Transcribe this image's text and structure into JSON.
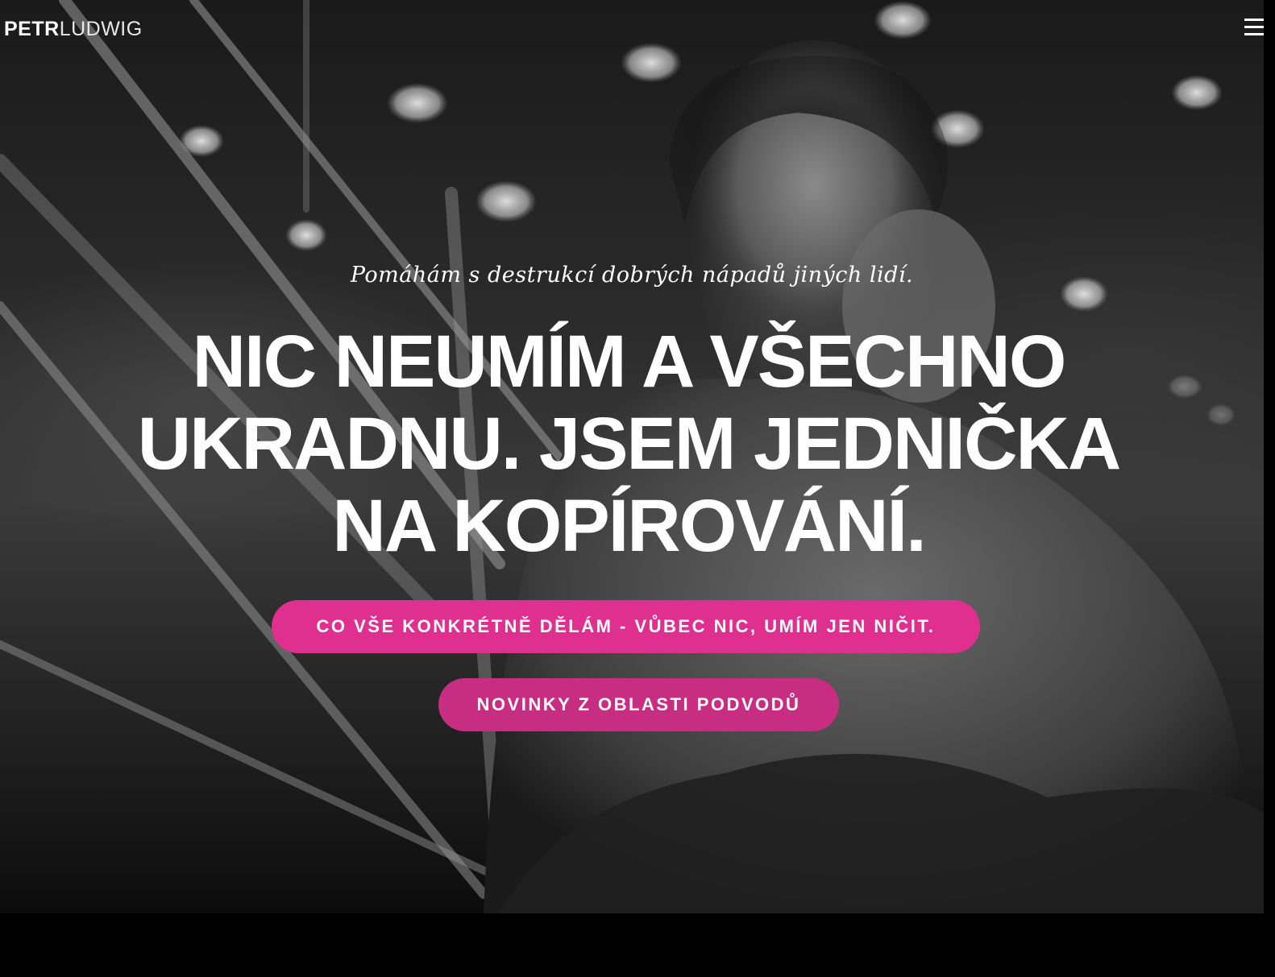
{
  "header": {
    "logo_bold": "PETR",
    "logo_light": "LUDWIG",
    "menu_icon": "hamburger-menu-icon"
  },
  "hero": {
    "tagline": "Pomáhám s destrukcí dobrých nápadů jiných lidí.",
    "headline_line1": "NIC NEUMÍM A VŠECHNO",
    "headline_line2": "UKRADNU. JSEM JEDNIČKA",
    "headline_line3": "NA KOPÍROVÁNÍ.",
    "primary_button": "CO VŠE KONKRÉTNĚ DĚLÁM - VŮBEC NIC, UMÍM JEN NIČIT.",
    "secondary_button": "NOVINKY Z OBLASTI PODVODŮ"
  },
  "colors": {
    "accent": "#e0308f",
    "accent_dark": "#c72d80",
    "background": "#000000",
    "text": "#ffffff"
  }
}
